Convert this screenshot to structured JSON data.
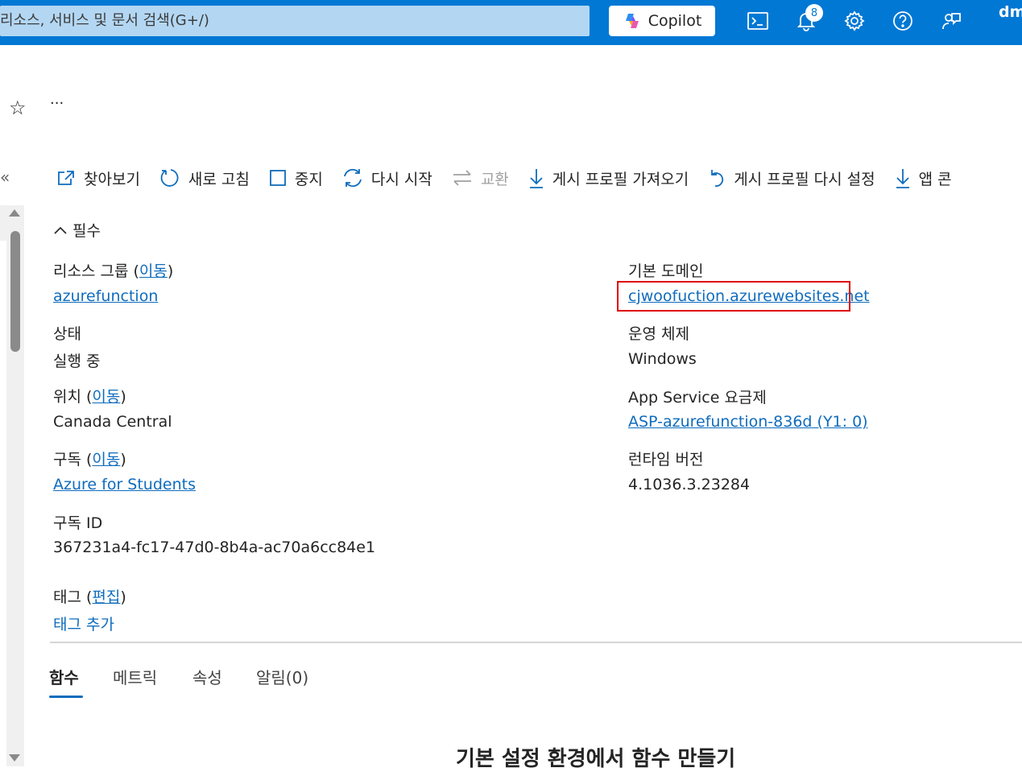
{
  "topbar": {
    "search_placeholder": "리소스, 서비스 및 문서 검색(G+/)",
    "copilot_label": "Copilot",
    "notification_count": "8",
    "user_initials": "dm"
  },
  "toolbar": {
    "browse": "찾아보기",
    "refresh": "새로 고침",
    "stop": "중지",
    "restart": "다시 시작",
    "swap": "교환",
    "get_publish_profile": "게시 프로필 가져오기",
    "reset_publish_profile": "게시 프로필 다시 설정",
    "download_app": "앱 콘"
  },
  "essentials": {
    "header": "필수",
    "resource_group_label": "리소스 그룹",
    "move_link": "이동",
    "resource_group_value": "azurefunction",
    "status_label": "상태",
    "status_value": "실행 중",
    "location_label": "위치",
    "location_value": "Canada Central",
    "subscription_label": "구독",
    "subscription_value": "Azure for Students",
    "subscription_id_label": "구독 ID",
    "subscription_id_value": "367231a4-fc17-47d0-8b4a-ac70a6cc84e1",
    "tags_label": "태그",
    "edit_link": "편집",
    "add_tag": "태그 추가",
    "default_domain_label": "기본 도메인",
    "default_domain_value": "cjwoofuction.azurewebsites.net",
    "os_label": "운영 체제",
    "os_value": "Windows",
    "plan_label": "App Service 요금제",
    "plan_value": "ASP-azurefunction-836d (Y1: 0)",
    "runtime_label": "런타임 버전",
    "runtime_value": "4.1036.3.23284"
  },
  "tabs": [
    "함수",
    "메트릭",
    "속성",
    "알림(0)"
  ],
  "main": {
    "section_title": "기본 설정 환경에서 함수 만들기"
  },
  "colors": {
    "brand": "#0078d4",
    "link": "#0f6cbd",
    "highlight": "#e00000"
  }
}
